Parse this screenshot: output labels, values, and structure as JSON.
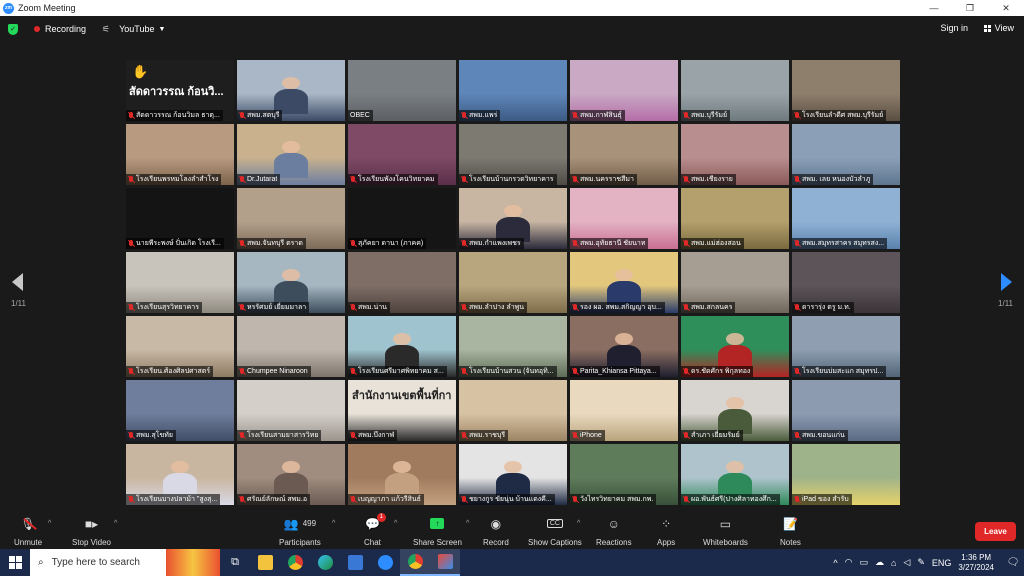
{
  "window": {
    "title": "Zoom Meeting",
    "app_icon": "zoom"
  },
  "topbar": {
    "recording_label": "Recording",
    "stream_label": "YouTube",
    "signin_label": "Sign in",
    "view_label": "View",
    "colors": {
      "shield": "#23d959",
      "recording_dot": "#e02828"
    }
  },
  "pagination": {
    "left": "1/11",
    "right": "1/11"
  },
  "tiles": [
    {
      "name": "สัดดาวรรณ ก้อนวิมล ธาตุ...",
      "big_name": "สัดดาวรรณ ก้อนวิ...",
      "hand_raised": true,
      "bg": "#1e1e1e",
      "tone": "#1e1e1e",
      "muted": true
    },
    {
      "name": "สพม.สตบุรี",
      "bg": "#a9b7c6",
      "tone": "#3d4a66",
      "muted": true,
      "person": true
    },
    {
      "name": "OBEC",
      "bg": "#7a7f84",
      "tone": "#5c5f63",
      "muted": false,
      "active": true
    },
    {
      "name": "สพม.แพร่",
      "bg": "#5f86b8",
      "tone": "#3c5b84",
      "muted": true
    },
    {
      "name": "สพม.กาฬสินธุ์",
      "bg": "#c9a9c4",
      "tone": "#b56ea8",
      "muted": true
    },
    {
      "name": "สพม.บุรีรัมย์",
      "bg": "#9aa4a8",
      "tone": "#6f7a7e",
      "muted": true
    },
    {
      "name": "โรงเรียนลำดีศ สพม.บุรีรัมย์",
      "bg": "#8e7f6c",
      "tone": "#5a4e42",
      "muted": true
    },
    {
      "name": "โรงเรียนพรหมโลงลำสำโรง",
      "bg": "#b79a80",
      "tone": "#7d634c",
      "muted": true
    },
    {
      "name": "Dr.Jutarat",
      "bg": "#c9b18d",
      "tone": "#6c7ea0",
      "muted": true,
      "person": true
    },
    {
      "name": "โรงเรียนพังงโคนวิทยาคม",
      "bg": "#7e4a66",
      "tone": "#5b2e49",
      "muted": true
    },
    {
      "name": "โรงเรียนบ้านกรวดวิทยาคาร",
      "bg": "#7d7a72",
      "tone": "#4e4b45",
      "muted": true
    },
    {
      "name": "สพม.นครราชสีมา",
      "bg": "#a8927a",
      "tone": "#705c48",
      "muted": true
    },
    {
      "name": "สพม.เชียงราย",
      "bg": "#b98e8e",
      "tone": "#8a5a5a",
      "muted": true
    },
    {
      "name": "สพม. เลย หนองบัวลำภู",
      "bg": "#8ba0b7",
      "tone": "#5f7690",
      "muted": true
    },
    {
      "name": "นายพีระพงษ์ ปั่นเกิด โรงเรี...",
      "bg": "#141414",
      "tone": "#141414",
      "muted": true
    },
    {
      "name": "สพม.จันทบุรี ตราด",
      "bg": "#b3a08b",
      "tone": "#7d6b59",
      "muted": true
    },
    {
      "name": "สุภัคยา ดานา (ภาคค)",
      "bg": "#151515",
      "tone": "#151515",
      "muted": true
    },
    {
      "name": "สพม.กำแพงเพชร",
      "bg": "#c8b6a3",
      "tone": "#2b2b3b",
      "muted": true,
      "person": true
    },
    {
      "name": "สพม.อุทัยธานี ชัยนาท",
      "bg": "#e3b2c3",
      "tone": "#c96f92",
      "muted": true
    },
    {
      "name": "สพม.แม่ฮ่องสอน",
      "bg": "#b4a06c",
      "tone": "#7a6a3f",
      "muted": true
    },
    {
      "name": "สพม.สมุทรสาคร สมุทรสง...",
      "bg": "#8fb2d4",
      "tone": "#5a82ad",
      "muted": true
    },
    {
      "name": "โรงเรียนสุรวิทยาคาร",
      "bg": "#c9c4bb",
      "tone": "#8f8a80",
      "muted": true
    },
    {
      "name": "หรรัศมย์ เยี่ยมมาลา",
      "bg": "#a6b7c2",
      "tone": "#3d4d5c",
      "muted": true,
      "person": true
    },
    {
      "name": "สพม.น่าน",
      "bg": "#7e6e66",
      "tone": "#4e423d",
      "muted": true
    },
    {
      "name": "สพม.ลำปาง ลำพูน",
      "bg": "#b8a67f",
      "tone": "#7f6c4a",
      "muted": true
    },
    {
      "name": "รอง ผอ. สพม.สกิญญา อุบ...",
      "bg": "#e2c77d",
      "tone": "#2a3b6b",
      "muted": true,
      "person": true
    },
    {
      "name": "สพม.สกลนคร",
      "bg": "#a69e92",
      "tone": "#6e665b",
      "muted": true
    },
    {
      "name": "ดารารุ่ง ตรู ม.ท.",
      "bg": "#5c5458",
      "tone": "#3a3337",
      "muted": true
    },
    {
      "name": "โรงเรียน.ศ้องศิลปศาสตร์",
      "bg": "#c8b9a6",
      "tone": "#8d7a62",
      "muted": true
    },
    {
      "name": "Chumpee Ninaroon",
      "bg": "#bfb6ad",
      "tone": "#7e756c",
      "muted": true
    },
    {
      "name": "โรงเรียนศรีมาศพิทยาคม ส...",
      "bg": "#9fc4cf",
      "tone": "#2a2a2a",
      "muted": true,
      "person": true
    },
    {
      "name": "โรงเรียนบ้านสวน (จันทอุทิ...",
      "bg": "#a9b4a1",
      "tone": "#5e6d58",
      "muted": true
    },
    {
      "name": "Parita_Khiansa Pittaya...",
      "bg": "#8b6e62",
      "tone": "#1f1f2f",
      "muted": true,
      "person": true
    },
    {
      "name": "ดร.ชัดศักร พิกุลทอง",
      "bg": "#2f8f5b",
      "tone": "#b32424",
      "muted": true,
      "person": true
    },
    {
      "name": "โรงเรียนบ่มสะแก สมุทรป...",
      "bg": "#8f9fb1",
      "tone": "#536479",
      "muted": true
    },
    {
      "name": "สพม.สุโขทัย",
      "bg": "#6f7e9c",
      "tone": "#404d66",
      "muted": true
    },
    {
      "name": "โรงเรียนสามยาสารวิทย",
      "bg": "#d4cfc9",
      "tone": "#9a948c",
      "muted": true
    },
    {
      "name": "สพม.บึงกาฬ",
      "bg": "#e8e2d8",
      "tone": "#2a2a2a",
      "muted": true,
      "banner": "สำนักงานเขตพื้นที่กา"
    },
    {
      "name": "สพม.ราชบุรี",
      "bg": "#d7c2a4",
      "tone": "#9b8462",
      "muted": true
    },
    {
      "name": "iPhone",
      "bg": "#e9d9bf",
      "tone": "#b9a47c",
      "muted": true
    },
    {
      "name": "สำเภา เยี่ยมรัมย์",
      "bg": "#d8d4cf",
      "tone": "#4a5b3b",
      "muted": true,
      "person": true
    },
    {
      "name": "สพม.ขอนแก่น",
      "bg": "#8c9bb0",
      "tone": "#5a6a82",
      "muted": true
    },
    {
      "name": "โรงเรียนบางปลาม้า \"สูงสุ...",
      "bg": "#c9b6a0",
      "tone": "#d9d9e6",
      "muted": true,
      "person": true
    },
    {
      "name": "ศรัณย์ลักษณ์ สพม.อ",
      "bg": "#a08d80",
      "tone": "#6a5a52",
      "muted": true,
      "person": true
    },
    {
      "name": "เบญญาภา แก้วรีสินธ์",
      "bg": "#a17b5d",
      "tone": "#c2a080",
      "muted": true,
      "person": true
    },
    {
      "name": "ชยางกูร ขัยนุ่น บ้านแดงคี...",
      "bg": "#e4e4e4",
      "tone": "#1f2a44",
      "muted": true,
      "person": true
    },
    {
      "name": "วังไทรวิทยาคม สพม.กพ.",
      "bg": "#5e7c5a",
      "tone": "#38503a",
      "muted": true
    },
    {
      "name": "ผอ.พันธ์ศรี(ปางศิลาทองศึก...",
      "bg": "#aec3cc",
      "tone": "#2e8a5a",
      "muted": true,
      "person": true
    },
    {
      "name": "iPad ของ สำรับ",
      "bg": "#9fb38a",
      "tone": "#e6d26a",
      "muted": true
    }
  ],
  "toolbar": {
    "unmute_label": "Unmute",
    "video_label": "Stop Video",
    "participants_label": "Participants",
    "participants_count": "499",
    "chat_label": "Chat",
    "chat_badge": "1",
    "share_label": "Share Screen",
    "record_label": "Record",
    "captions_label": "Show Captions",
    "reactions_label": "Reactions",
    "apps_label": "Apps",
    "whiteboards_label": "Whiteboards",
    "notes_label": "Notes",
    "leave_label": "Leave",
    "colors": {
      "leave": "#e02828",
      "share": "#23d959"
    }
  },
  "taskbar": {
    "search_placeholder": "Type here to search",
    "lang": "ENG",
    "time": "1:36 PM",
    "date": "3/27/2024"
  }
}
